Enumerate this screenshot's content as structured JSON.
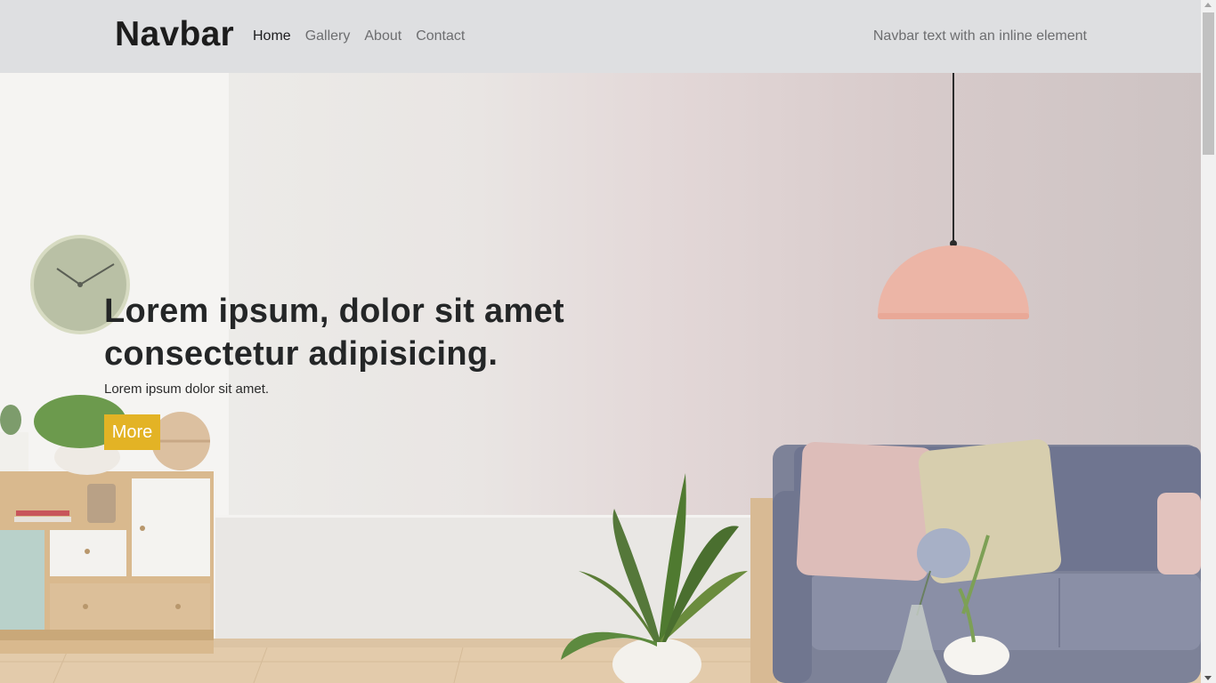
{
  "navbar": {
    "brand": "Navbar",
    "links": [
      {
        "label": "Home",
        "active": true
      },
      {
        "label": "Gallery",
        "active": false
      },
      {
        "label": "About",
        "active": false
      },
      {
        "label": "Contact",
        "active": false
      }
    ],
    "text": "Navbar text with an inline element"
  },
  "hero": {
    "title": "Lorem ipsum, dolor sit amet consectetur adipisicing.",
    "subtitle": "Lorem ipsum dolor sit amet.",
    "button_label": "More",
    "background_image": "living-room-interior"
  },
  "colors": {
    "navbar_bg": "#dedfe1",
    "button_bg": "#e3b325",
    "heading_text": "#242627",
    "nav_link": "#6d6e70",
    "nav_link_active": "#1d1d1f"
  }
}
